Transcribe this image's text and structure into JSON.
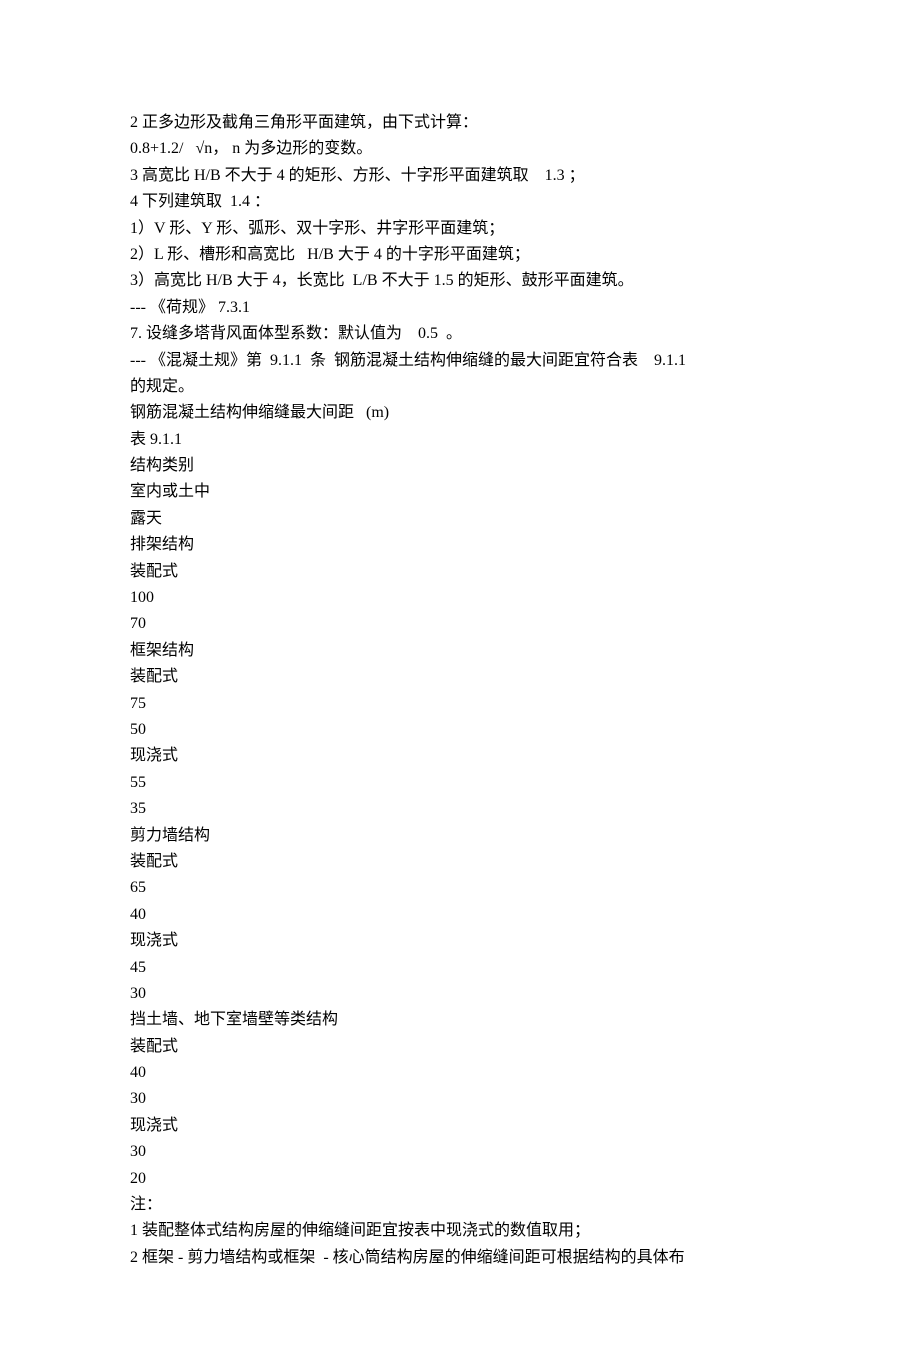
{
  "lines": [
    "2 正多边形及截角三角形平面建筑，由下式计算：",
    "0.8+1.2/   √n， n 为多边形的变数。",
    "3 高宽比 H/B 不大于 4 的矩形、方形、十字形平面建筑取    1.3 ；",
    "4 下列建筑取  1.4 ：",
    "1）V 形、Y 形、弧形、双十字形、井字形平面建筑；",
    "2）L 形、槽形和高宽比   H/B 大于 4 的十字形平面建筑；",
    "3）高宽比 H/B 大于 4，长宽比  L/B 不大于 1.5 的矩形、鼓形平面建筑。",
    "--- 《荷规》 7.3.1",
    "7. 设缝多塔背风面体型系数：默认值为    0.5  。",
    "--- 《混凝土规》第  9.1.1  条  钢筋混凝土结构伸缩缝的最大间距宜符合表    9.1.1",
    "的规定。",
    "钢筋混凝土结构伸缩缝最大间距   (m)",
    "表 9.1.1",
    "结构类别",
    "室内或土中",
    "露天",
    "排架结构",
    "装配式",
    "100",
    "70",
    "框架结构",
    "装配式",
    "75",
    "50",
    "现浇式",
    "55",
    "35",
    "剪力墙结构",
    "装配式",
    "65",
    "40",
    "现浇式",
    "45",
    "30",
    "挡土墙、地下室墙壁等类结构",
    "装配式",
    "40",
    "30",
    "现浇式",
    "30",
    "20",
    "注：",
    "1 装配整体式结构房屋的伸缩缝间距宜按表中现浇式的数值取用；",
    "2 框架 - 剪力墙结构或框架  - 核心筒结构房屋的伸缩缝间距可根据结构的具体布"
  ],
  "chart_data": {
    "type": "table",
    "title": "钢筋混凝土结构伸缩缝最大间距 (m)",
    "table_ref": "表 9.1.1",
    "columns": [
      "结构类别",
      "",
      "室内或土中",
      "露天"
    ],
    "rows": [
      [
        "排架结构",
        "装配式",
        100,
        70
      ],
      [
        "框架结构",
        "装配式",
        75,
        50
      ],
      [
        "框架结构",
        "现浇式",
        55,
        35
      ],
      [
        "剪力墙结构",
        "装配式",
        65,
        40
      ],
      [
        "剪力墙结构",
        "现浇式",
        45,
        30
      ],
      [
        "挡土墙、地下室墙壁等类结构",
        "装配式",
        40,
        30
      ],
      [
        "挡土墙、地下室墙壁等类结构",
        "现浇式",
        30,
        20
      ]
    ],
    "notes": [
      "1 装配整体式结构房屋的伸缩缝间距宜按表中现浇式的数值取用；",
      "2 框架 - 剪力墙结构或框架 - 核心筒结构房屋的伸缩缝间距可根据结构的具体布"
    ]
  }
}
